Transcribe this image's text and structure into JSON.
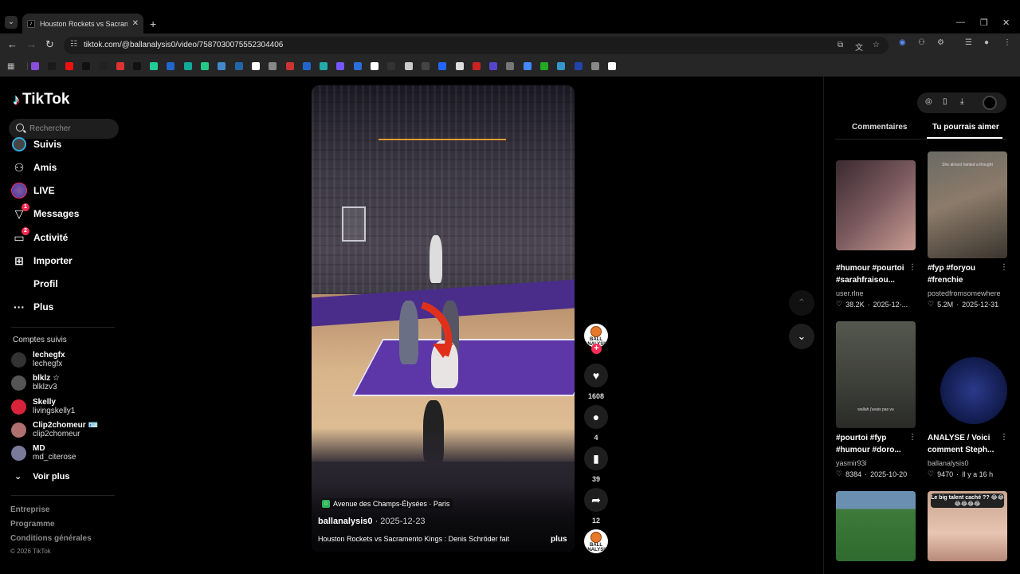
{
  "browser": {
    "tab_title": "Houston Rockets vs Sacramento Kings",
    "new_tab": "+",
    "url": "tiktok.com/@ballanalysis0/video/7587030075552304406",
    "bookmark_colors": [
      "#8a4ddc",
      "#1a1a1a",
      "#e11",
      "#111",
      "#222",
      "#d33",
      "#111",
      "#2c9",
      "#26c",
      "#1a9",
      "#2c8",
      "#48c",
      "#26a",
      "#fff",
      "#888",
      "#c33",
      "#26c",
      "#2aa",
      "#75f",
      "#2a6fdb",
      "#fff",
      "#333",
      "#ccc",
      "#444",
      "#26f",
      "#ddd",
      "#c22",
      "#54c",
      "#777",
      "#48f",
      "#2a2",
      "#39c",
      "#24a",
      "#888",
      "#fff"
    ]
  },
  "tiktok": {
    "logo": "TikTok",
    "search_placeholder": "Rechercher",
    "nav": {
      "suivis": "Suivis",
      "amis": "Amis",
      "live": "LIVE",
      "messages": "Messages",
      "messages_badge": "1",
      "activite": "Activité",
      "activite_badge": "2",
      "importer": "Importer",
      "profil": "Profil",
      "plus": "Plus"
    },
    "followed_label": "Comptes suivis",
    "accounts": [
      {
        "name": "lechegfx",
        "handle": "lechegfx",
        "color": "#333"
      },
      {
        "name": "blklz ☆",
        "handle": "blklzv3",
        "color": "#555"
      },
      {
        "name": "Skelly",
        "handle": "livingskelly1",
        "color": "#d9233a"
      },
      {
        "name": "Clip2chomeur 🪪",
        "handle": "clip2chomeur",
        "color": "#b07070"
      },
      {
        "name": "MD",
        "handle": "md_citerose",
        "color": "#7a7a9a"
      }
    ],
    "see_more": "Voir plus",
    "footer": {
      "entreprise": "Entreprise",
      "programme": "Programme",
      "conditions": "Conditions générales",
      "copyright": "© 2026 TikTok"
    }
  },
  "video": {
    "location": "Avenue des Champs-Élysées · Paris",
    "author": "ballanalysis0",
    "date": "· 2025-12-23",
    "description": "Houston Rockets vs Sacramento Kings : Denis Schröder fait",
    "more": "plus",
    "avatar_text": "BALL ANALYSIS",
    "likes": "1608",
    "comments": "4",
    "saves": "39",
    "shares": "12"
  },
  "panel": {
    "tab_comments": "Commentaires",
    "tab_suggest": "Tu pourrais aimer",
    "cards": [
      {
        "title": "#humour #pourtoi #sarahfraisou...",
        "user": "user.rlne",
        "views": "38.2K",
        "date": "2025-12-...",
        "thumb_text": ""
      },
      {
        "title": "#fyp #foryou #frenchie",
        "user": "postedfromsomewhere",
        "views": "5.2M",
        "date": "2025-12-31",
        "thumb_text": "She almost fainted a thought"
      },
      {
        "title": "#pourtoi #fyp #humour #doro...",
        "user": "yasmir93i",
        "views": "8384",
        "date": "2025-10-20",
        "thumb_text": "wallah j'avais pas vu"
      },
      {
        "title": "ANALYSE / Voici comment Steph...",
        "user": "ballanalysis0",
        "views": "9470",
        "date": "Il y a 16 h",
        "thumb_text": ""
      },
      {
        "title": "",
        "user": "",
        "views": "",
        "date": "",
        "thumb_text": ""
      },
      {
        "title": "",
        "user": "",
        "views": "",
        "date": "",
        "thumb_text": "Le big talent caché ?? 😂😂😂😂😂😂"
      }
    ]
  }
}
